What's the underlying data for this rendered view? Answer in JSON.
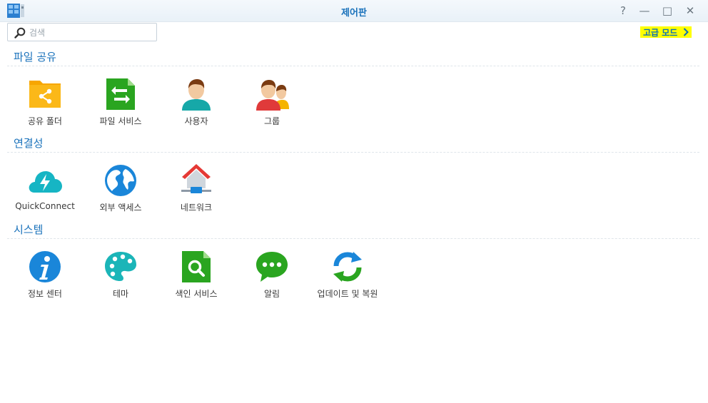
{
  "window": {
    "title": "제어판",
    "help_glyph": "?",
    "min_glyph": "—",
    "max_glyph": "□",
    "close_glyph": "✕"
  },
  "search": {
    "placeholder": "검색",
    "value": ""
  },
  "advanced_mode": {
    "label": "고급 모드",
    "highlight": "#ffff00"
  },
  "accent": "#1a72bb",
  "sections": [
    {
      "title": "파일 공유",
      "items": [
        {
          "label": "공유 폴더",
          "icon": "shared-folder-icon"
        },
        {
          "label": "파일 서비스",
          "icon": "file-services-icon"
        },
        {
          "label": "사용자",
          "icon": "user-icon"
        },
        {
          "label": "그룹",
          "icon": "group-icon"
        }
      ]
    },
    {
      "title": "연결성",
      "items": [
        {
          "label": "QuickConnect",
          "icon": "quickconnect-icon"
        },
        {
          "label": "외부 액세스",
          "icon": "external-access-icon"
        },
        {
          "label": "네트워크",
          "icon": "network-icon"
        }
      ]
    },
    {
      "title": "시스템",
      "items": [
        {
          "label": "정보 센터",
          "icon": "info-center-icon"
        },
        {
          "label": "테마",
          "icon": "theme-palette-icon"
        },
        {
          "label": "색인 서비스",
          "icon": "indexing-service-icon"
        },
        {
          "label": "알림",
          "icon": "notification-icon"
        },
        {
          "label": "업데이트 및 복원",
          "icon": "update-restore-icon"
        }
      ]
    }
  ]
}
